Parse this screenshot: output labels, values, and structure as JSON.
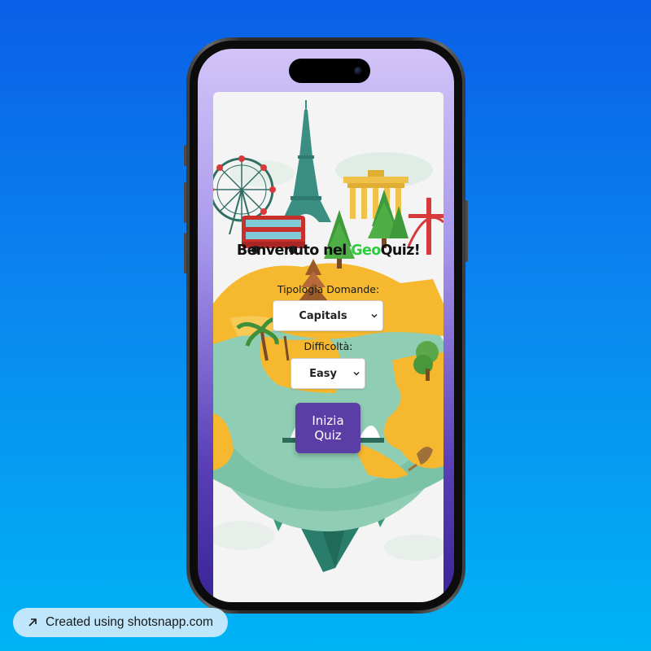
{
  "app": {
    "title_prefix": "Benvenuto nel ",
    "title_highlight": "Geo",
    "title_suffix": "Quiz!"
  },
  "form": {
    "question_type_label": "Tipologia Domande:",
    "question_type_value": "Capitals",
    "difficulty_label": "Difficoltà:",
    "difficulty_value": "Easy",
    "start_button_line1": "Inizia",
    "start_button_line2": "Quiz"
  },
  "watermark": {
    "text": "Created using shotsnapp.com",
    "icon": "arrow-up-right-icon"
  },
  "colors": {
    "background_top": "#0a5fe6",
    "background_bottom": "#00b4f4",
    "accent_button": "#5b3ea5",
    "geo_highlight": "#2ecc40"
  }
}
